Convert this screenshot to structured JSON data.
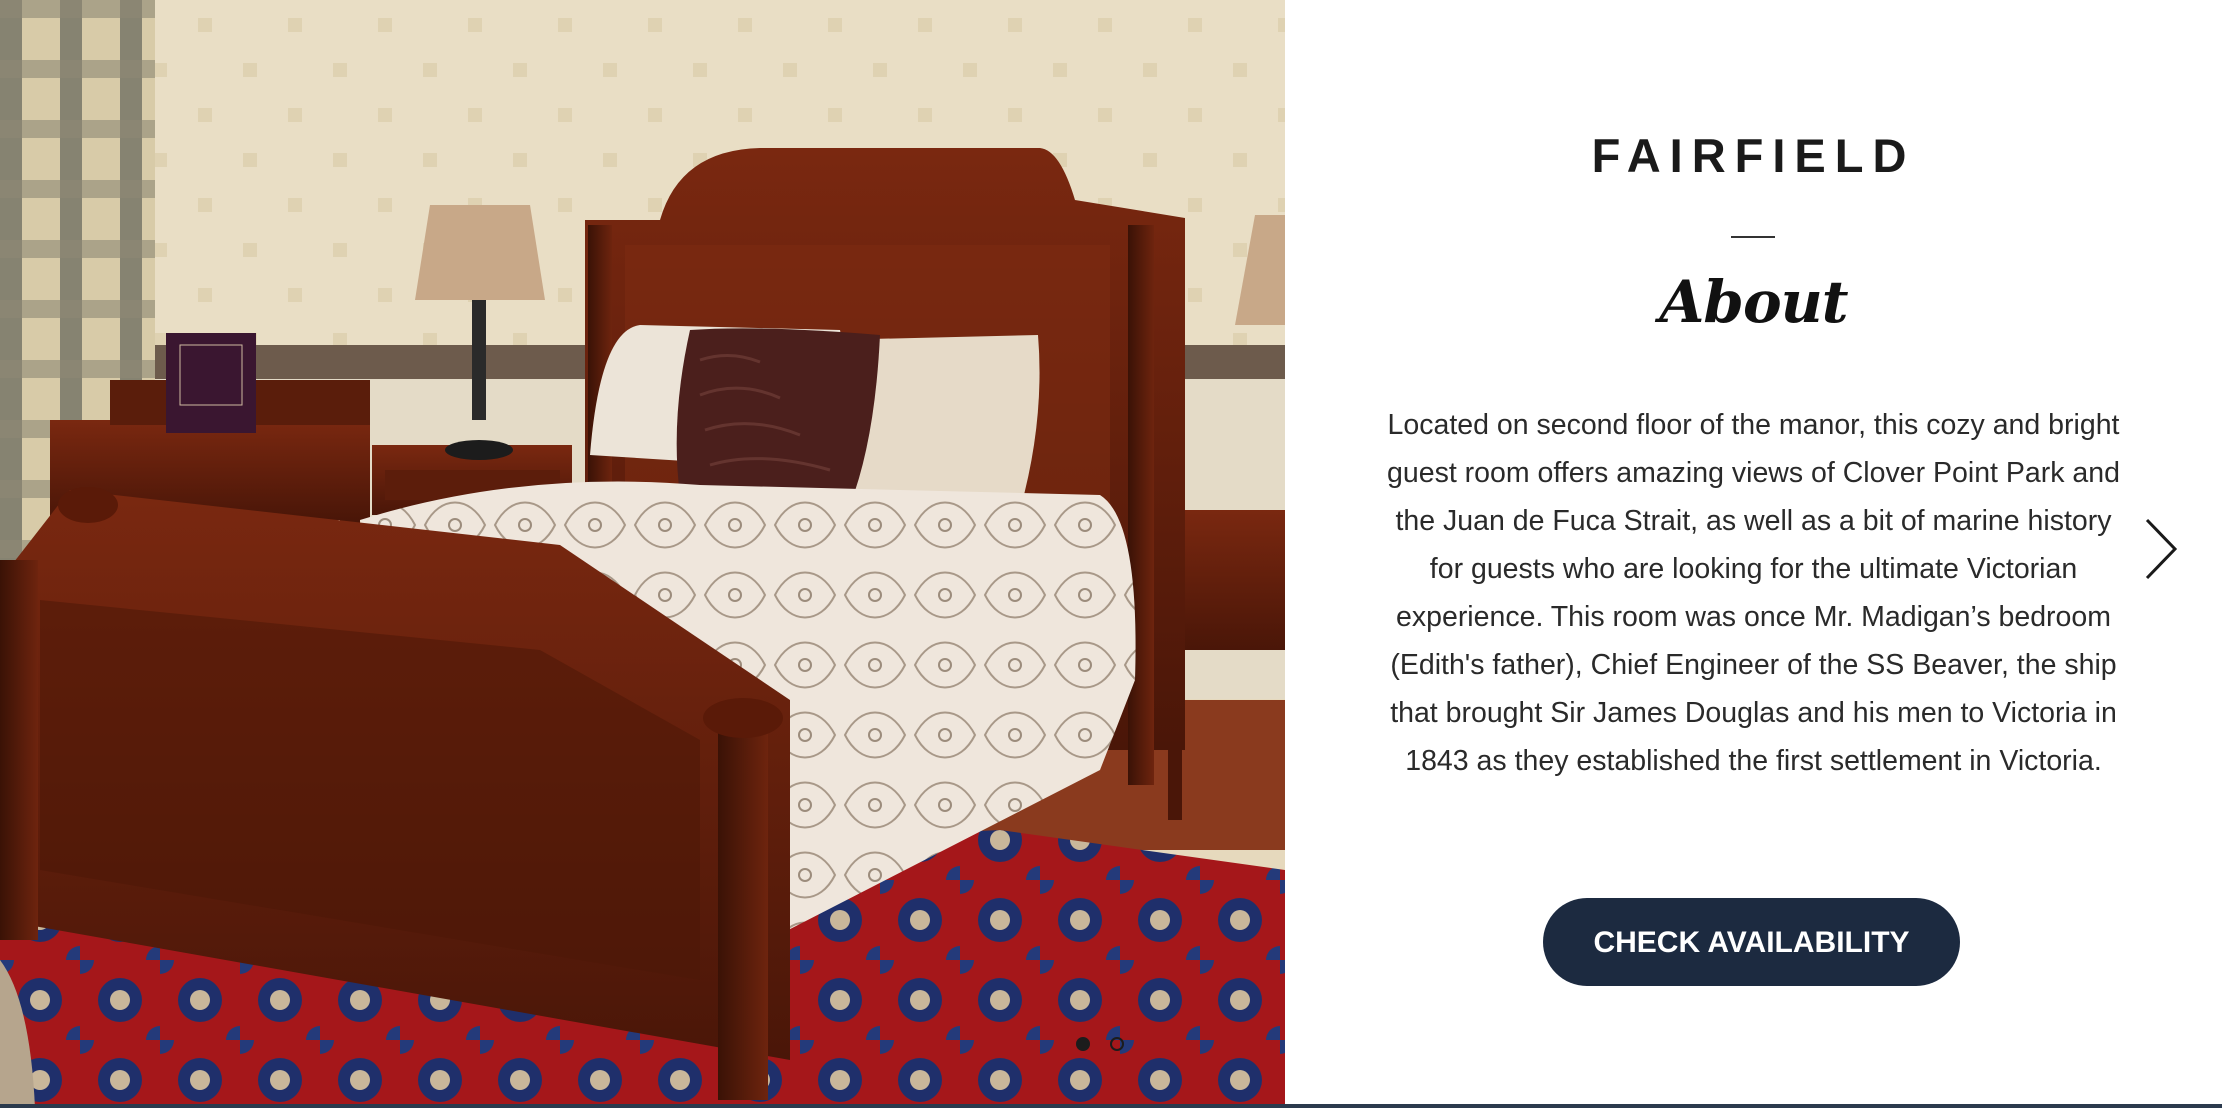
{
  "room": {
    "title": "FAIRFIELD",
    "section_heading": "About",
    "description": "Located on second floor of the manor, this cozy and bright guest room offers amazing views of Clover Point Park and the Juan de Fuca Strait, as well as a bit of marine history for guests who are looking for the ultimate Victorian experience. This room was once Mr. Madigan’s bedroom (Edith's father), Chief Engineer of the SS Beaver, the ship that brought Sir James Douglas and his men to Victoria in 1843 as they established the first settlement in Victoria.",
    "cta_label": "CHECK AVAILABILITY"
  },
  "carousel": {
    "slide_count": 2,
    "active_index": 0,
    "next_icon": "chevron-right-icon"
  },
  "colors": {
    "button_bg": "#1c2a40",
    "accent": "#2b3a4d"
  }
}
